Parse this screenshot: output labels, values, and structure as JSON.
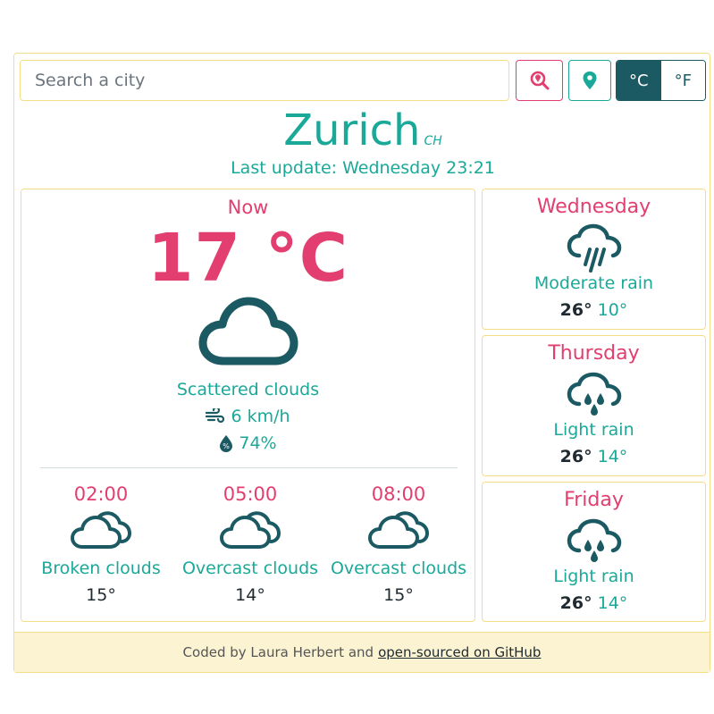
{
  "search": {
    "placeholder": "Search a city"
  },
  "buttons": {
    "search_icon": "search-location-icon",
    "location_icon": "map-pin-icon"
  },
  "units": {
    "celsius": "°C",
    "fahrenheit": "°F",
    "active": "°C"
  },
  "city": {
    "name": "Zurich",
    "country": "CH"
  },
  "last_update": "Last update: Wednesday 23:21",
  "now": {
    "label": "Now",
    "temperature": "17 °C",
    "icon": "cloud-icon",
    "description": "Scattered clouds",
    "wind": "6 km/h",
    "humidity": "74%"
  },
  "hourly": [
    {
      "time": "02:00",
      "icon": "broken-clouds-icon",
      "description": "Broken clouds",
      "temp": "15°"
    },
    {
      "time": "05:00",
      "icon": "overcast-clouds-icon",
      "description": "Overcast clouds",
      "temp": "14°"
    },
    {
      "time": "08:00",
      "icon": "overcast-clouds-icon",
      "description": "Overcast clouds",
      "temp": "15°"
    }
  ],
  "daily": [
    {
      "day": "Wednesday",
      "icon": "heavy-rain-icon",
      "description": "Moderate rain",
      "max": "26°",
      "min": "10°"
    },
    {
      "day": "Thursday",
      "icon": "light-rain-icon",
      "description": "Light rain",
      "max": "26°",
      "min": "14°"
    },
    {
      "day": "Friday",
      "icon": "light-rain-icon",
      "description": "Light rain",
      "max": "26°",
      "min": "14°"
    }
  ],
  "footer": {
    "text": "Coded by Laura Herbert and",
    "link": "open-sourced on GitHub"
  },
  "colors": {
    "accent_pink": "#e23e6f",
    "accent_teal": "#1aa998",
    "dark": "#1c5a63",
    "border": "#f3de86",
    "footer_bg": "#fbf3d2"
  }
}
